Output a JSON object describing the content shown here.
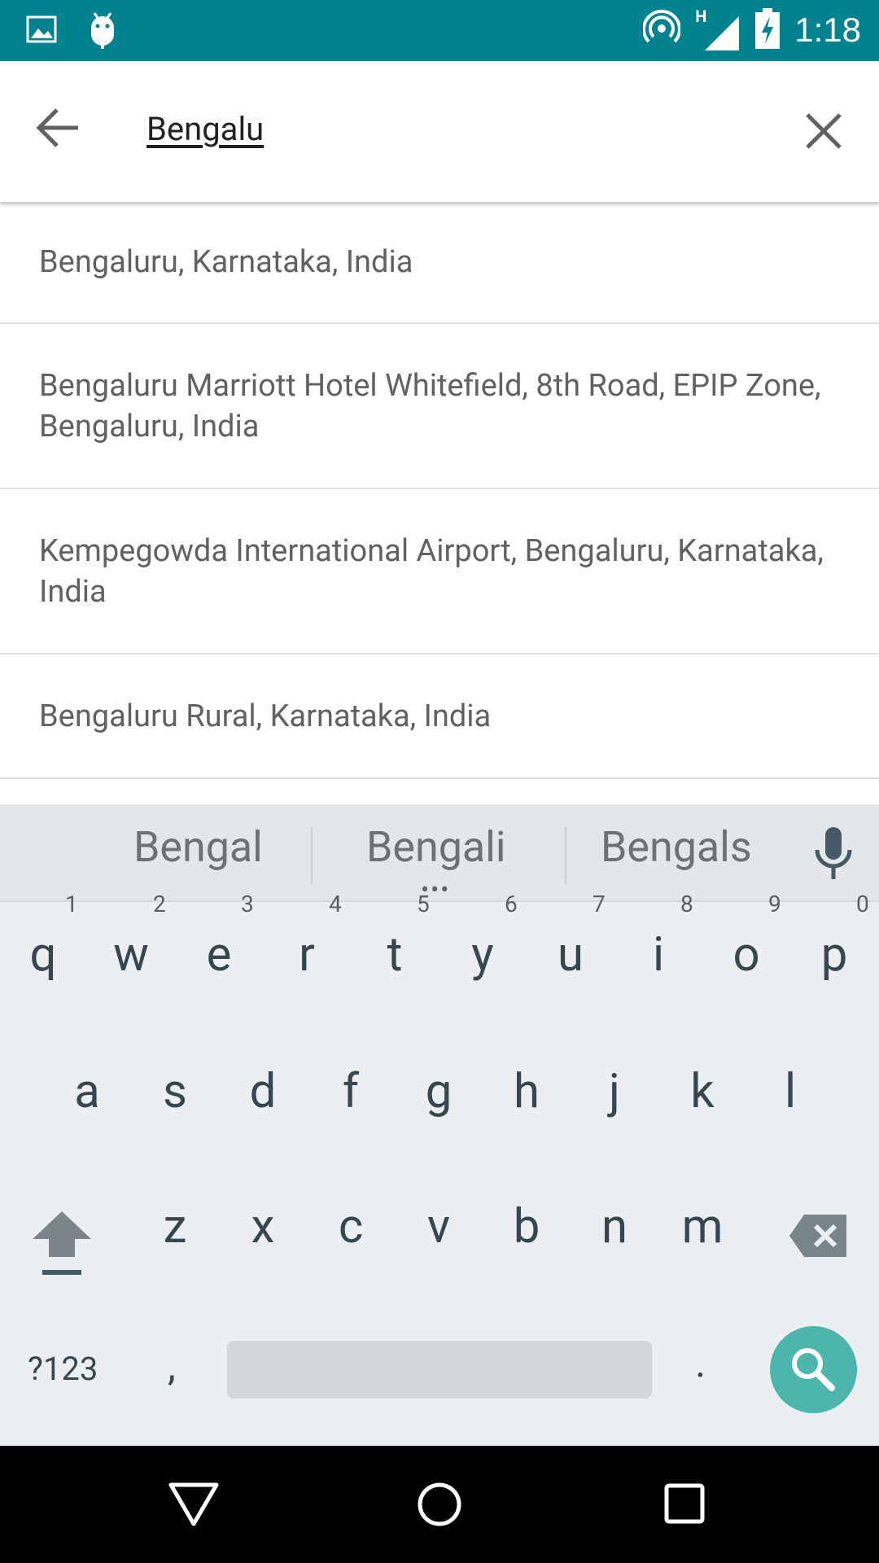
{
  "status_bar": {
    "time": "1:18",
    "network_label": "H",
    "icons": [
      "image-notification-icon",
      "android-debug-icon",
      "hotspot-icon",
      "signal-icon",
      "battery-charging-icon"
    ]
  },
  "search": {
    "query": "Bengalu"
  },
  "results": [
    "Bengaluru, Karnataka, India",
    "Bengaluru Marriott Hotel Whitefield, 8th Road, EPIP Zone, Bengaluru, India",
    "Kempegowda International Airport, Bengaluru, Karnataka, India",
    "Bengaluru Rural, Karnataka, India"
  ],
  "keyboard": {
    "suggestions": [
      "Bengal",
      "Bengali",
      "Bengals"
    ],
    "row1": [
      "q",
      "w",
      "e",
      "r",
      "t",
      "y",
      "u",
      "i",
      "o",
      "p"
    ],
    "row1_hints": [
      "1",
      "2",
      "3",
      "4",
      "5",
      "6",
      "7",
      "8",
      "9",
      "0"
    ],
    "row2": [
      "a",
      "s",
      "d",
      "f",
      "g",
      "h",
      "j",
      "k",
      "l"
    ],
    "row3": [
      "z",
      "x",
      "c",
      "v",
      "b",
      "n",
      "m"
    ],
    "symbols_key": "?123",
    "comma_key": ",",
    "period_key": "."
  },
  "colors": {
    "status_bar": "#00838f",
    "search_key": "#4db6ac",
    "keyboard_bg": "#eceff1"
  }
}
